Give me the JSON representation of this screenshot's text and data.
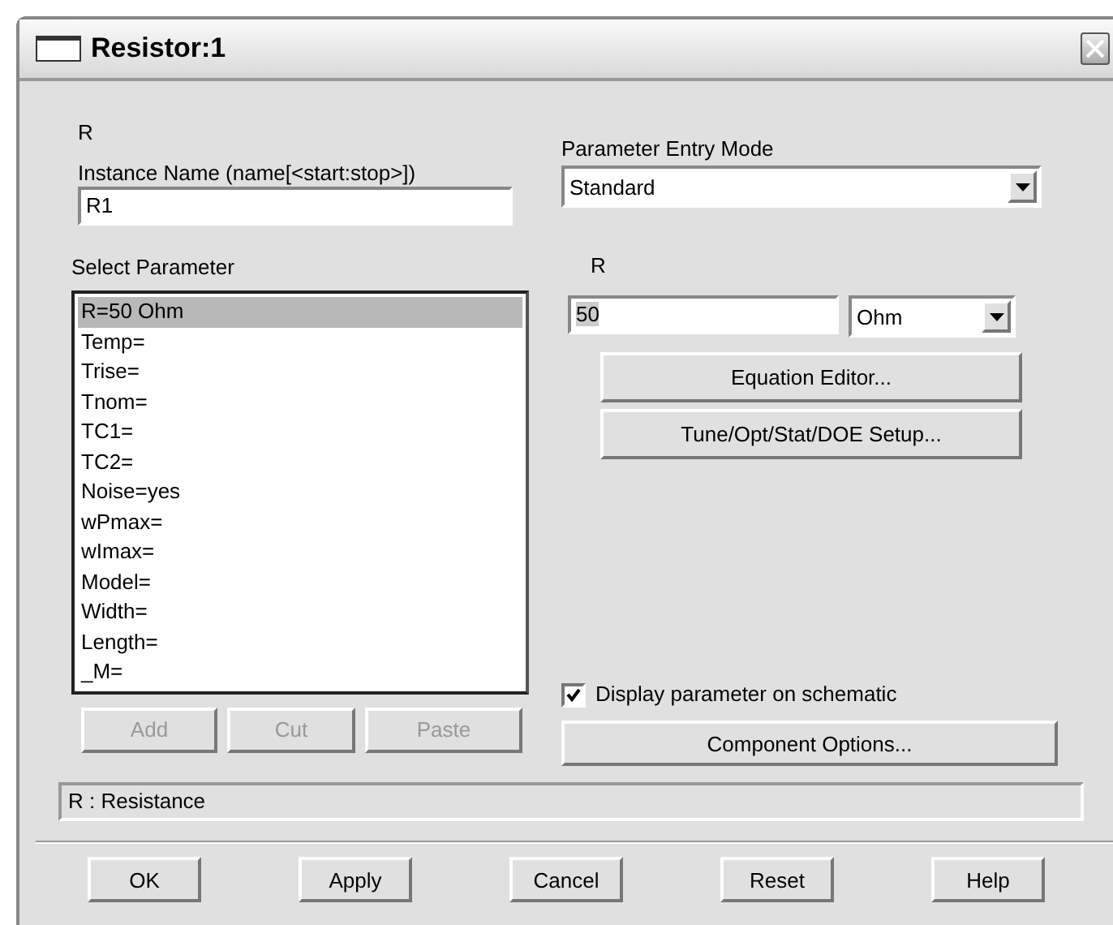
{
  "window": {
    "title": "Resistor:1"
  },
  "component_label": "R",
  "instance_name": {
    "label": "Instance Name  (name[<start:stop>])",
    "value": "R1"
  },
  "select_parameter": {
    "label": "Select Parameter",
    "items": [
      {
        "text": "R=50 Ohm",
        "selected": true
      },
      {
        "text": "Temp=",
        "selected": false
      },
      {
        "text": "Trise=",
        "selected": false
      },
      {
        "text": "Tnom=",
        "selected": false
      },
      {
        "text": "TC1=",
        "selected": false
      },
      {
        "text": "TC2=",
        "selected": false
      },
      {
        "text": "Noise=yes",
        "selected": false
      },
      {
        "text": "wPmax=",
        "selected": false
      },
      {
        "text": "wImax=",
        "selected": false
      },
      {
        "text": "Model=",
        "selected": false
      },
      {
        "text": "Width=",
        "selected": false
      },
      {
        "text": "Length=",
        "selected": false
      },
      {
        "text": "_M=",
        "selected": false
      }
    ]
  },
  "list_buttons": [
    {
      "label": "Add",
      "disabled": true
    },
    {
      "label": "Cut",
      "disabled": true
    },
    {
      "label": "Paste",
      "disabled": true
    }
  ],
  "entry_mode": {
    "label": "Parameter Entry Mode",
    "value": "Standard"
  },
  "parameter": {
    "label": "R",
    "value": "50",
    "unit": "Ohm"
  },
  "parameter_buttons": [
    "Equation Editor...",
    "Tune/Opt/Stat/DOE Setup..."
  ],
  "display_on_schematic": {
    "label": "Display parameter on schematic",
    "checked": true
  },
  "component_options": "Component Options...",
  "status": "R : Resistance",
  "footer_buttons": [
    "OK",
    "Apply",
    "Cancel",
    "Reset",
    "Help"
  ]
}
